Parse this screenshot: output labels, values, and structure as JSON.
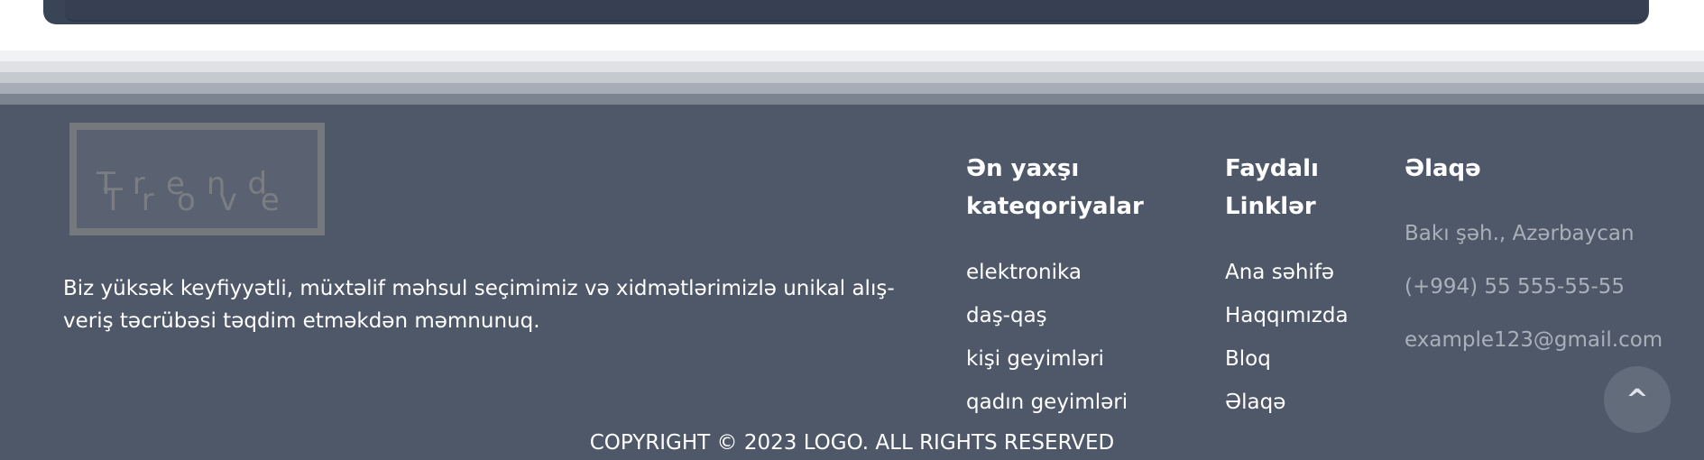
{
  "logo": {
    "line1": "Trend",
    "line2": "Trove",
    "alt": "Trend Trove"
  },
  "about": {
    "text": "Biz yüksək keyfiyyətli, müxtəlif məhsul seçimimiz və xidmətlərimizlə unikal alış-veriş təcrübəsi təqdim etməkdən məmnunuq."
  },
  "categories": {
    "title": "Ən yaxşı kateqoriyalar",
    "items": [
      "elektronika",
      "daş-qaş",
      "kişi geyimləri",
      "qadın geyimləri"
    ]
  },
  "links": {
    "title": "Faydalı Linklər",
    "items": [
      "Ana səhifə",
      "Haqqımızda",
      "Bloq",
      "Əlaqə"
    ]
  },
  "contact": {
    "title": "Əlaqə",
    "items": [
      "Bakı şəh., Azərbaycan",
      "(+994) 55 555-55-55",
      "example123@gmail.com"
    ]
  },
  "copyright": "COPYRIGHT © 2023 LOGO. ALL RIGHTS RESERVED",
  "scroll_top": {
    "label": "^"
  },
  "colors": {
    "footer_bg": "#4f5869",
    "muted_text": "#aab0b9",
    "header_bg": "#3a4457"
  }
}
